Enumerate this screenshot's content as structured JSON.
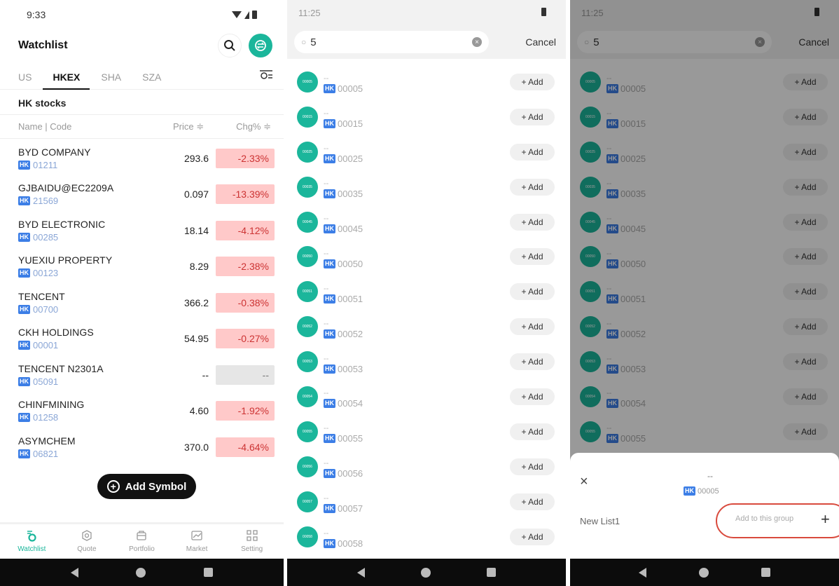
{
  "panel1": {
    "status_time": "9:33",
    "title": "Watchlist",
    "tabs": [
      "US",
      "HKEX",
      "SHA",
      "SZA"
    ],
    "active_tab": "HKEX",
    "section": "HK stocks",
    "columns": {
      "name": "Name | Code",
      "price": "Price ≑",
      "chg": "Chg% ≑"
    },
    "rows": [
      {
        "name": "BYD COMPANY",
        "code": "01211",
        "price": "293.6",
        "chg": "-2.33%"
      },
      {
        "name": "GJBAIDU@EC2209A",
        "code": "21569",
        "price": "0.097",
        "chg": "-13.39%"
      },
      {
        "name": "BYD ELECTRONIC",
        "code": "00285",
        "price": "18.14",
        "chg": "-4.12%"
      },
      {
        "name": "YUEXIU PROPERTY",
        "code": "00123",
        "price": "8.29",
        "chg": "-2.38%"
      },
      {
        "name": "TENCENT",
        "code": "00700",
        "price": "366.2",
        "chg": "-0.38%"
      },
      {
        "name": "CKH HOLDINGS",
        "code": "00001",
        "price": "54.95",
        "chg": "-0.27%"
      },
      {
        "name": "TENCENT N2301A",
        "code": "05091",
        "price": "--",
        "chg": "--"
      },
      {
        "name": "CHINFMINING",
        "code": "01258",
        "price": "4.60",
        "chg": "-1.92%"
      },
      {
        "name": "ASYMCHEM",
        "code": "06821",
        "price": "370.0",
        "chg": "-4.64%"
      }
    ],
    "hk_badge": "HK",
    "add_symbol": "Add Symbol",
    "nav": [
      "Watchlist",
      "Quote",
      "Portfolio",
      "Market",
      "Setting"
    ]
  },
  "panel2": {
    "status_time": "11:25",
    "search_value": "5",
    "cancel": "Cancel",
    "add_label": "+ Add",
    "dash": "--",
    "results": [
      "00005",
      "00015",
      "00025",
      "00035",
      "00045",
      "00050",
      "00051",
      "00052",
      "00053",
      "00054",
      "00055",
      "00056",
      "00057",
      "00058"
    ]
  },
  "panel3": {
    "status_time": "11:25",
    "search_value": "5",
    "cancel": "Cancel",
    "add_label": "+ Add",
    "results": [
      "00005",
      "00015",
      "00025",
      "00035",
      "00045",
      "00050",
      "00051",
      "00052",
      "00053",
      "00054",
      "00055"
    ],
    "sheet": {
      "close": "×",
      "name": "--",
      "code": "00005",
      "list_name": "New List1",
      "add_to_group": "Add to this group",
      "plus": "+"
    }
  },
  "colors": {
    "accent": "#1bb69b",
    "down_bg": "#ffc9c9",
    "down_text": "#cc3333",
    "hk_badge": "#3c7ee6",
    "highlight_ring": "#d94a3d"
  }
}
